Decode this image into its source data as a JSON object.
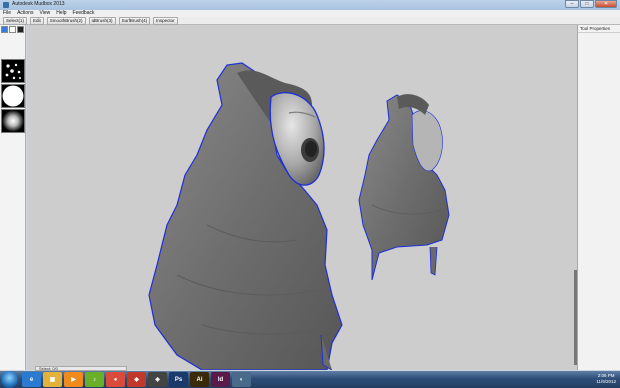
{
  "window": {
    "title": "Autodesk Mudbox 2013"
  },
  "menu": [
    "File",
    "Actions",
    "View",
    "Help",
    "Feedback"
  ],
  "toolbar": [
    "Select(1)",
    "Edit",
    "SmoothBrush(2)",
    "IdBrush(3)",
    "SurfBrush(4)",
    "Inspector"
  ],
  "right_panel": {
    "title": "Tool Properties"
  },
  "status": {
    "text": "Select: 0/0"
  },
  "clock": {
    "time": "2:06 PM",
    "date": "11/9/2012"
  },
  "taskbar_icons": [
    {
      "name": "ie-icon",
      "color": "#2a7ad2",
      "glyph": "e"
    },
    {
      "name": "explorer-icon",
      "color": "#e2b23a",
      "glyph": "▣"
    },
    {
      "name": "media-player-icon",
      "color": "#f08a1c",
      "glyph": "▶"
    },
    {
      "name": "spotify-icon",
      "color": "#6aaf2a",
      "glyph": "♪"
    },
    {
      "name": "chrome-icon",
      "color": "#d94b3b",
      "glyph": "●"
    },
    {
      "name": "red-app-icon",
      "color": "#c0392b",
      "glyph": "◆"
    },
    {
      "name": "unity-icon",
      "color": "#444",
      "glyph": "◈"
    },
    {
      "name": "photoshop-icon",
      "color": "#1a3a6b",
      "glyph": "Ps"
    },
    {
      "name": "illustrator-icon",
      "color": "#3a2a0a",
      "glyph": "Ai"
    },
    {
      "name": "indesign-icon",
      "color": "#5a1a4a",
      "glyph": "Id"
    },
    {
      "name": "mudbox-icon",
      "color": "#4a6a8a",
      "glyph": "◐"
    }
  ],
  "colors": {
    "edge": "#1f2fd6",
    "mesh": "#6e6e6e",
    "face": "#bfbfbf",
    "viewport_bg": "#cdcdcd"
  }
}
